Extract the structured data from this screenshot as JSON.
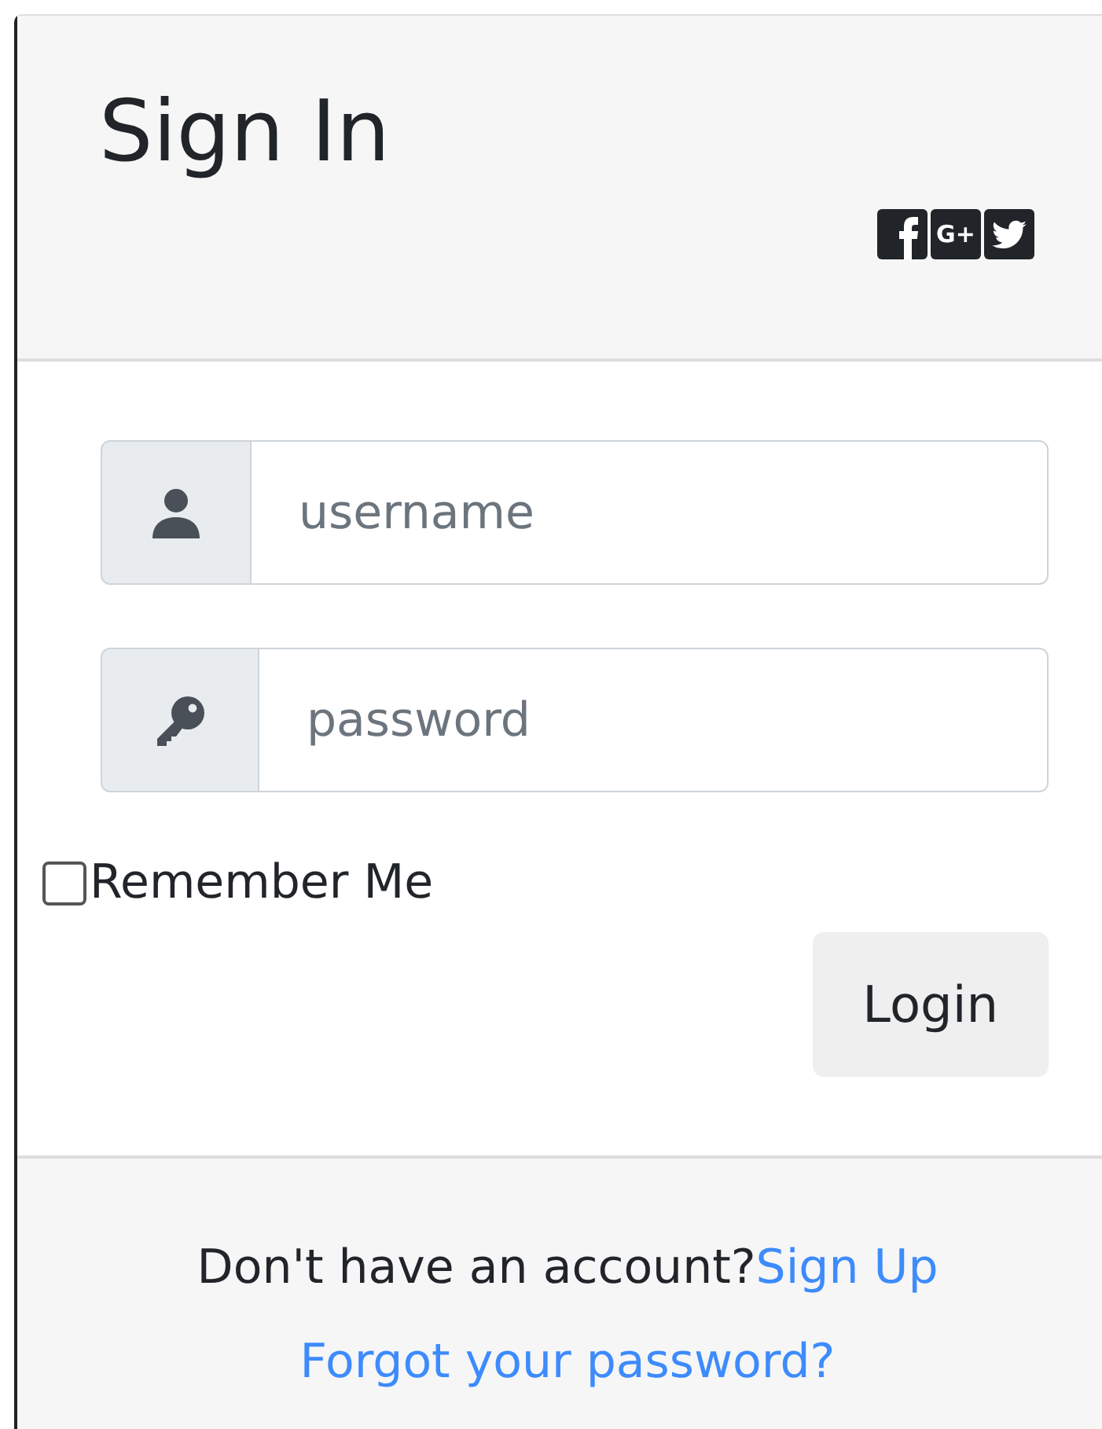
{
  "card": {
    "title": "Sign In",
    "social": [
      {
        "kind": "facebook"
      },
      {
        "kind": "google-plus",
        "text": "G+"
      },
      {
        "kind": "twitter"
      }
    ]
  },
  "fields": [
    {
      "kind": "user",
      "placeholder": "username"
    },
    {
      "kind": "key",
      "placeholder": "password"
    }
  ],
  "remember": {
    "label": "Remember Me",
    "checked": false
  },
  "login_button": "Login",
  "footer": {
    "prompt": "Don't have an account?",
    "signup_link": "Sign Up",
    "forgot_link": "Forgot your password?"
  }
}
